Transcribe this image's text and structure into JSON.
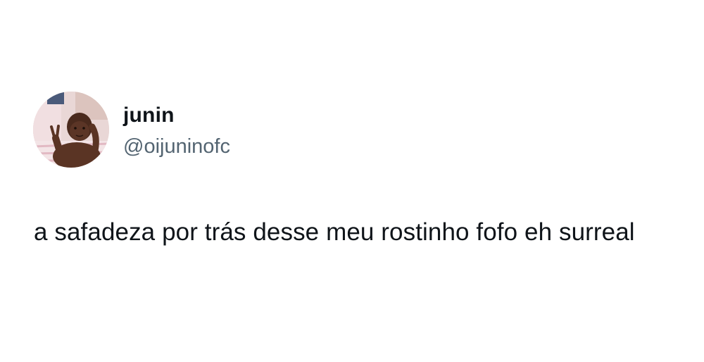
{
  "author": {
    "display_name": "junin",
    "handle": "@oijuninofc",
    "avatar_icon": "profile-photo"
  },
  "tweet": {
    "text": "a safadeza por trás desse meu rostinho fofo eh surreal"
  },
  "colors": {
    "background": "#ffffff",
    "primary_text": "#0f1419",
    "secondary_text": "#536471"
  }
}
